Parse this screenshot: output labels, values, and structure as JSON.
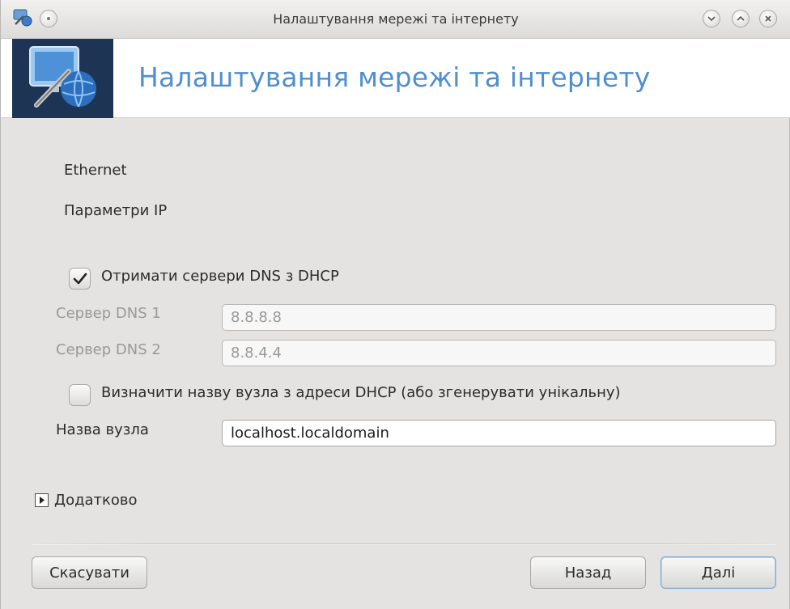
{
  "window": {
    "title": "Налаштування мережі та інтернету",
    "title_buttons": [
      "minimize-icon",
      "maximize-icon",
      "close-icon"
    ]
  },
  "banner": {
    "title": "Налаштування мережі та інтернету",
    "logo_icon": "network-config-icon"
  },
  "info": {
    "interface": "Ethernet",
    "section": "Параметри IP"
  },
  "dns": {
    "checkbox_label": "Отримати сервери DNS з DHCP",
    "checked": true,
    "server1_label": "Сервер DNS 1",
    "server1_value": "8.8.8.8",
    "server2_label": "Сервер DNS 2",
    "server2_value": "8.8.4.4"
  },
  "hostname": {
    "checkbox_label": "Визначити назву вузла з адреси DHCP (або згенерувати унікальну)",
    "checked": false,
    "label": "Назва вузла",
    "value": "localhost.localdomain"
  },
  "advanced": {
    "label": "Додатково"
  },
  "buttons": {
    "cancel": "Скасувати",
    "back": "Назад",
    "next": "Далі"
  },
  "colors": {
    "accent": "#4f8fd0",
    "window_bg": "#e4e3e1",
    "disabled_text": "#9a9997"
  }
}
